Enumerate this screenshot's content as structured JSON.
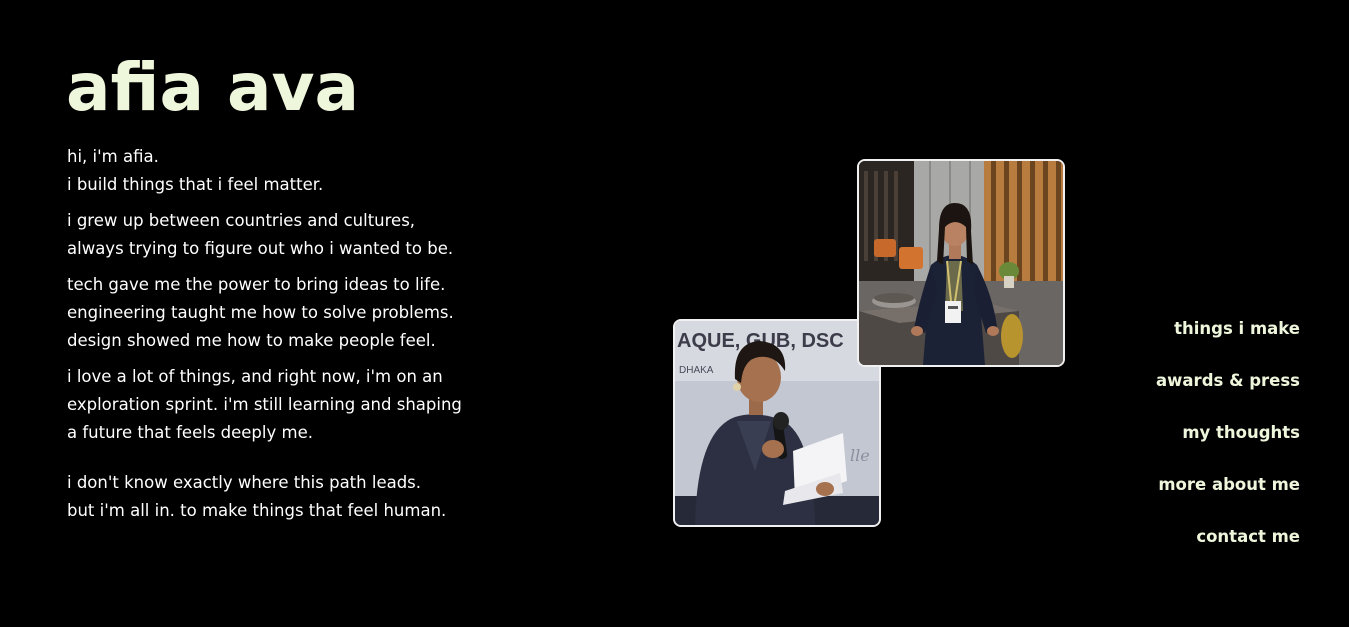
{
  "header": {
    "name": "afia ava"
  },
  "bio": {
    "paragraphs": [
      [
        "hi, i'm afia.",
        "i build things that i feel matter."
      ],
      [
        "i grew up between countries and cultures,",
        "always trying to figure out who i wanted to be."
      ],
      [
        "tech gave me the power to bring ideas to life.",
        "engineering taught me how to solve problems.",
        "design showed me how to make people feel."
      ],
      [
        "i love a lot of things, and right now, i'm on an",
        "exploration sprint. i'm still learning and shaping",
        "a future that feels deeply me."
      ],
      [
        "i don't know exactly where this path leads.",
        "but i'm all in. to make things that feel human."
      ]
    ]
  },
  "photos": {
    "top": "photo of afia in a blazer wearing a lanyard badge",
    "bottom": "photo of afia speaking at a podium with a microphone"
  },
  "nav": {
    "items": [
      "things i make",
      "awards & press",
      "my thoughts",
      "more about me",
      "contact me"
    ]
  },
  "colors": {
    "background": "#000000",
    "heading": "#eef6dc",
    "text": "#ffffff",
    "photo_border": "#f1f1f1"
  }
}
